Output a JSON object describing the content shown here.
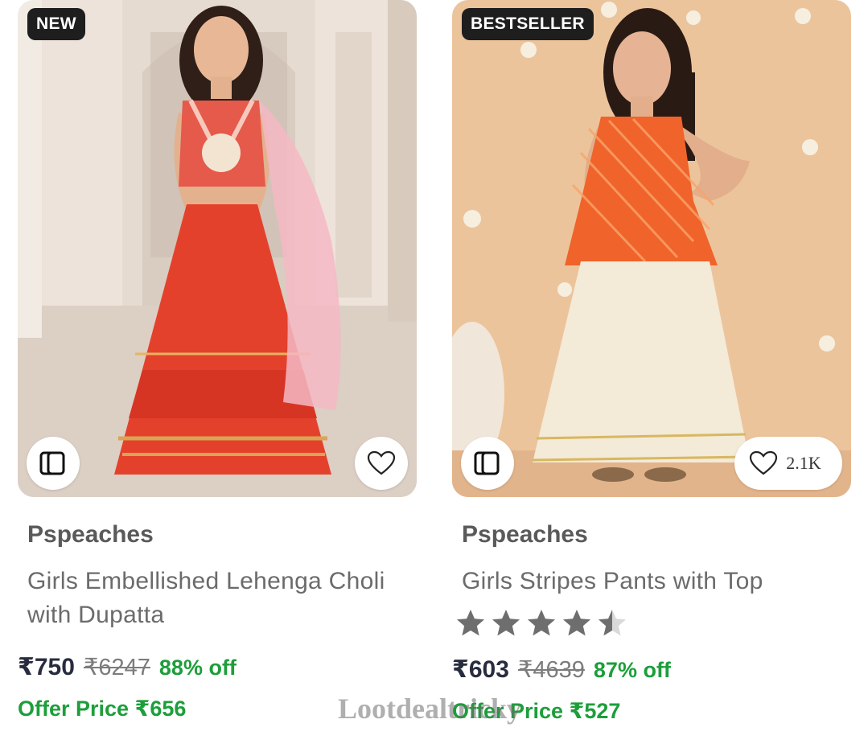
{
  "products": [
    {
      "tag": "NEW",
      "brand": "Pspeaches",
      "title": "Girls Embellished Lehenga Choli with Dupatta",
      "price": "₹750",
      "mrp": "₹6247",
      "discount": "88% off",
      "offer_price": "Offer Price ₹656",
      "wishlist_count": "",
      "icons": [
        "similar-products-icon",
        "heart-icon"
      ]
    },
    {
      "tag": "BESTSELLER",
      "brand": "Pspeaches",
      "title": "Girls Stripes Pants with Top",
      "rating": 4.5,
      "price": "₹603",
      "mrp": "₹4639",
      "discount": "87% off",
      "offer_price": "Offer Price ₹527",
      "wishlist_count": "2.1K",
      "icons": [
        "similar-products-icon",
        "heart-icon",
        "star-icon"
      ]
    }
  ],
  "watermark": "Lootdealtricky",
  "colors": {
    "discount_green": "#1d9e3b",
    "tag_bg": "#1e1e1e",
    "star_gray": "#6e6e6e",
    "left_outfit": "#e4412c",
    "right_top": "#f0632a"
  }
}
